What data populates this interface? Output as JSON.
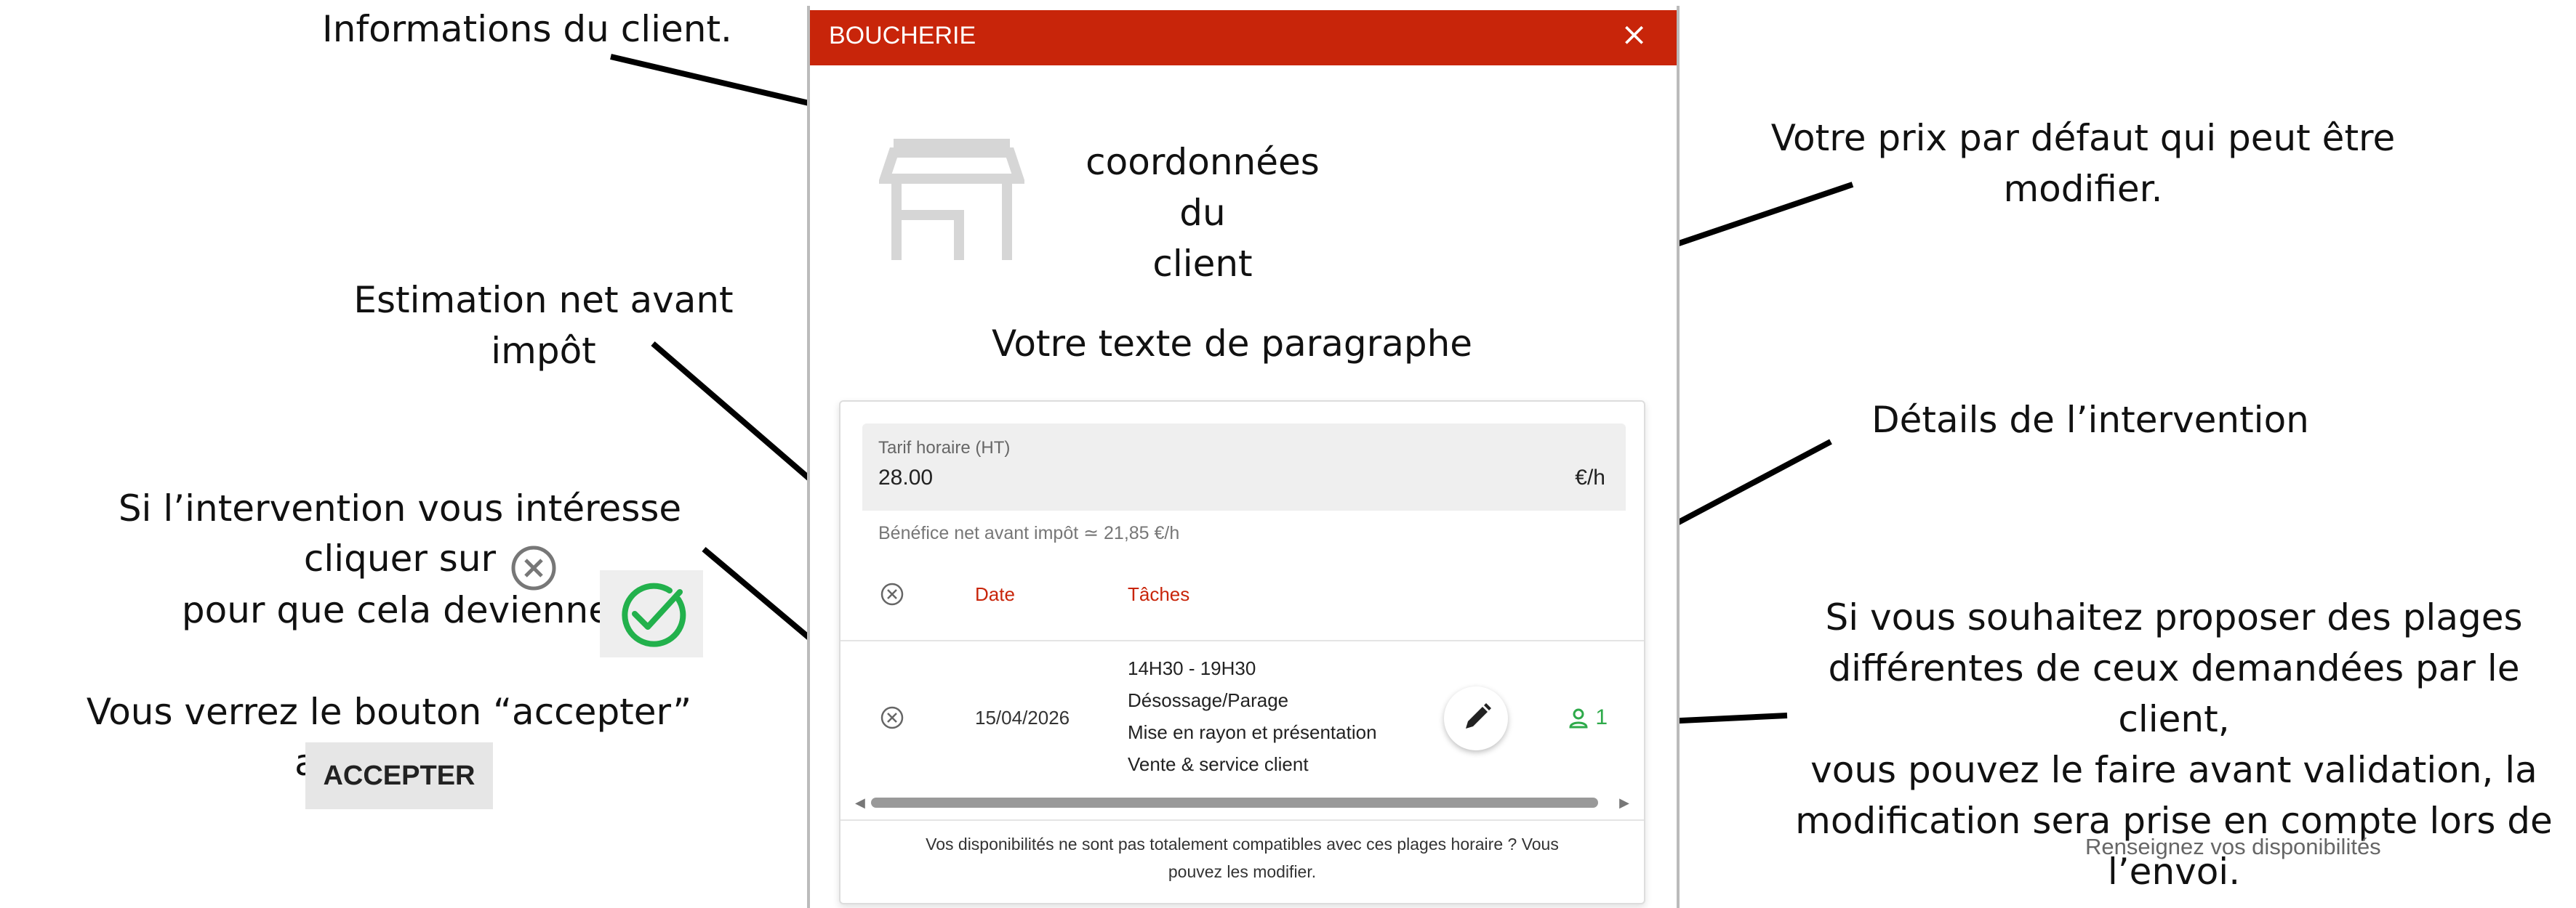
{
  "annotations": {
    "client_info": "Informations du client.",
    "default_price": "Votre prix par défaut qui peut être modifier.",
    "estimate_line1": "Estimation net avant",
    "estimate_line2": "impôt",
    "details": "Détails de l’intervention",
    "interest_line1": "Si l’intervention vous intéresse",
    "interest_line2": "cliquer sur",
    "interest_line3": "pour que cela devienne",
    "accept_info": "Vous verrez le bouton “accepter” apparaitre",
    "propose_line1": "Si vous souhaitez proposer des plages",
    "propose_line2": "différentes de ceux demandées par le client,",
    "propose_line3": "vous pouvez le faire avant validation, la",
    "propose_line4": "modification sera prise en compte lors de",
    "propose_line5": "l’envoi."
  },
  "dialog": {
    "title": "BOUCHERIE",
    "close": "×",
    "client_line1": "coordonnées du",
    "client_line2": "client",
    "paragraph": "Votre texte de paragraphe"
  },
  "rate": {
    "label": "Tarif horaire (HT)",
    "value": "28.00",
    "unit": "€/h"
  },
  "benefit": "Bénéfice net avant impôt ≃ 21,85 €/h",
  "table": {
    "headers": {
      "date": "Date",
      "tasks": "Tâches"
    },
    "row": {
      "date": "15/04/2026",
      "time": "14H30 - 19H30",
      "tasks": [
        "Désossage/Parage",
        "Mise en rayon et présentation",
        "Vente & service client"
      ],
      "persons": "1"
    }
  },
  "footer_note_line1": "Vos disponibilités ne sont pas totalement compatibles avec ces plages horaire ? Vous",
  "footer_note_line2": "pouvez les modifier.",
  "accept_button": "ACCEPTER",
  "availability_hint": "Renseignez vos disponibilités",
  "colors": {
    "header": "#c8250a",
    "accent_red": "#c8250a",
    "green": "#2eaa4a"
  },
  "icons": [
    "shop-icon",
    "close-circle-icon",
    "check-circle-icon",
    "pencil-icon",
    "person-icon"
  ]
}
